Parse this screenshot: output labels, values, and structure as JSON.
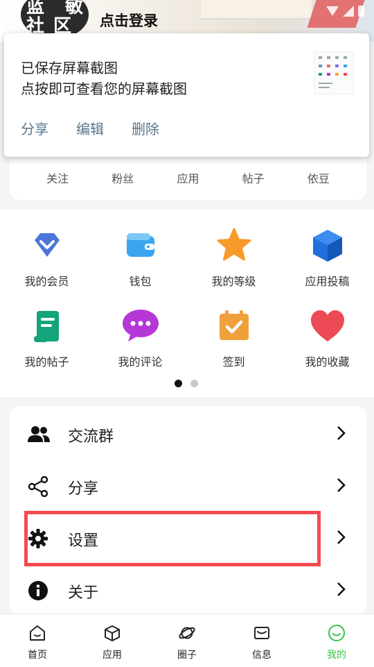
{
  "header": {
    "avatar_text": "蓝　敏\n社 区",
    "login_label": "点击登录"
  },
  "notification": {
    "title": "已保存屏幕截图",
    "subtitle": "点按即可查看您的屏幕截图",
    "actions": [
      "分享",
      "编辑",
      "删除"
    ]
  },
  "stats": [
    "关注",
    "粉丝",
    "应用",
    "帖子",
    "依豆"
  ],
  "grid": {
    "items": [
      {
        "label": "我的会员",
        "icon": "vip-diamond-icon",
        "color": "#4a76d9"
      },
      {
        "label": "钱包",
        "icon": "wallet-icon",
        "color": "#3aa6f0"
      },
      {
        "label": "我的等级",
        "icon": "star-icon",
        "color": "#f89a2a"
      },
      {
        "label": "应用投稿",
        "icon": "cube-icon",
        "color": "#1f6fdc"
      },
      {
        "label": "我的帖子",
        "icon": "scroll-icon",
        "color": "#14a37a"
      },
      {
        "label": "我的评论",
        "icon": "comment-bubble-icon",
        "color": "#b537d6"
      },
      {
        "label": "签到",
        "icon": "calendar-check-icon",
        "color": "#f0a03a"
      },
      {
        "label": "我的收藏",
        "icon": "heart-icon",
        "color": "#ec4a55"
      }
    ],
    "page_count": 2,
    "active_page": 1
  },
  "menu": {
    "items": [
      {
        "label": "交流群",
        "icon": "group-icon"
      },
      {
        "label": "分享",
        "icon": "share-icon"
      },
      {
        "label": "设置",
        "icon": "gear-icon"
      },
      {
        "label": "关于",
        "icon": "info-icon"
      }
    ]
  },
  "bottom_nav": {
    "items": [
      {
        "label": "首页",
        "icon": "home-icon"
      },
      {
        "label": "应用",
        "icon": "box-icon"
      },
      {
        "label": "圈子",
        "icon": "planet-icon"
      },
      {
        "label": "信息",
        "icon": "mail-icon"
      },
      {
        "label": "我的",
        "icon": "smile-icon",
        "active": true
      }
    ]
  },
  "colors": {
    "accent_green": "#35c24a",
    "highlight_red": "#f44a4f",
    "action_text": "#57768c"
  }
}
